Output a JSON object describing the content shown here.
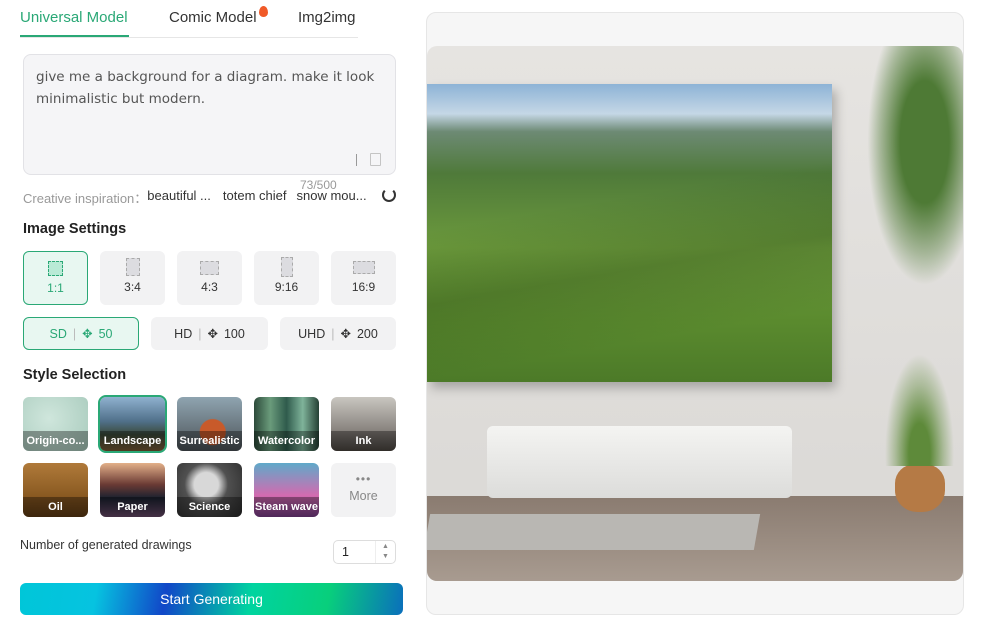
{
  "tabs": [
    {
      "label": "Universal Model",
      "active": true
    },
    {
      "label": "Comic Model",
      "badge": "fire-icon"
    },
    {
      "label": "Img2img"
    }
  ],
  "prompt": {
    "value": "give me a background for a diagram. make it look minimalistic but modern.",
    "count": "73/500"
  },
  "inspiration": {
    "label": "Creative inspiration：",
    "chips": [
      "beautiful ...",
      "totem chief",
      "snow mou..."
    ]
  },
  "image_settings": {
    "title": "Image Settings",
    "ratios": [
      "1:1",
      "3:4",
      "4:3",
      "9:16",
      "16:9"
    ],
    "selected_ratio": "1:1",
    "quality": [
      {
        "label": "SD",
        "cost": "50"
      },
      {
        "label": "HD",
        "cost": "100"
      },
      {
        "label": "UHD",
        "cost": "200"
      }
    ],
    "selected_quality": "SD"
  },
  "style": {
    "title": "Style Selection",
    "items": [
      "Origin-co...",
      "Landscape",
      "Surrealistic",
      "Watercolor",
      "Ink",
      "Oil",
      "Paper",
      "Science",
      "Steam wave"
    ],
    "selected": "Landscape",
    "more_label": "More"
  },
  "count": {
    "label": "Number of generated drawings",
    "value": "1"
  },
  "start_label": "Start Generating",
  "colors": {
    "accent": "#2aa876"
  }
}
